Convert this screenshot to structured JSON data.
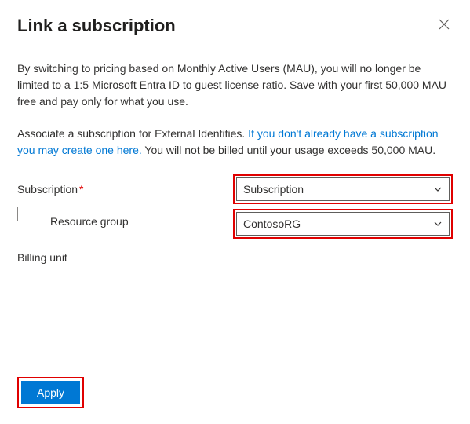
{
  "header": {
    "title": "Link a subscription"
  },
  "body": {
    "intro": "By switching to pricing based on Monthly Active Users (MAU), you will no longer be limited to a 1:5 Microsoft Entra ID to guest license ratio. Save with your first 50,000 MAU free and pay only for what you use.",
    "associate_prefix": "Associate a subscription for External Identities. ",
    "associate_link": "If you don't already have a subscription you may create one here.",
    "associate_suffix": " You will not be billed until your usage exceeds 50,000 MAU."
  },
  "fields": {
    "subscription": {
      "label": "Subscription",
      "value": "Subscription",
      "required": true
    },
    "resource_group": {
      "label": "Resource group",
      "value": "ContosoRG"
    },
    "billing_unit": {
      "label": "Billing unit"
    }
  },
  "footer": {
    "apply_label": "Apply"
  }
}
